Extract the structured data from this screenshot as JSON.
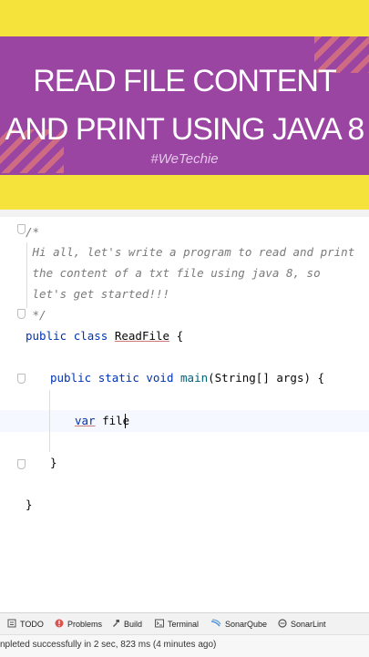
{
  "banner": {
    "title_line1": "READ FILE CONTENT",
    "title_line2": "AND PRINT USING JAVA 8",
    "hashtag": "#WeTechie"
  },
  "editor": {
    "lines": {
      "c_open": "/*",
      "c1": " Hi all, let's write a program to read and print",
      "c2": " the content of a txt file using java 8, so",
      "c3": " let's get started!!!",
      "c_close": " */",
      "kw_public1": "public",
      "kw_class": "class",
      "class_name": "ReadFile",
      "brace_open1": "{",
      "kw_public2": "public",
      "kw_static": "static",
      "kw_void": "void",
      "method_name": "main",
      "params": "(String[] args) {",
      "kw_var": "var",
      "typed": "file",
      "brace_close_method": "}",
      "brace_close_class": "}"
    }
  },
  "toolbar": {
    "items": [
      {
        "label": "TODO",
        "icon": "list-icon"
      },
      {
        "label": "Problems",
        "icon": "problems-icon"
      },
      {
        "label": "Build",
        "icon": "build-icon"
      },
      {
        "label": "Terminal",
        "icon": "terminal-icon"
      },
      {
        "label": "SonarQube",
        "icon": "sonarqube-icon"
      },
      {
        "label": "SonarLint",
        "icon": "sonarlint-icon"
      }
    ]
  },
  "status": {
    "text": "npleted successfully in 2 sec, 823 ms (4 minutes ago)"
  },
  "colors": {
    "banner_purple": "#9b45a3",
    "banner_yellow": "#f5e23a",
    "keyword_blue": "#0033b3",
    "method_teal": "#00627a",
    "comment_grey": "#7a7a7a"
  }
}
